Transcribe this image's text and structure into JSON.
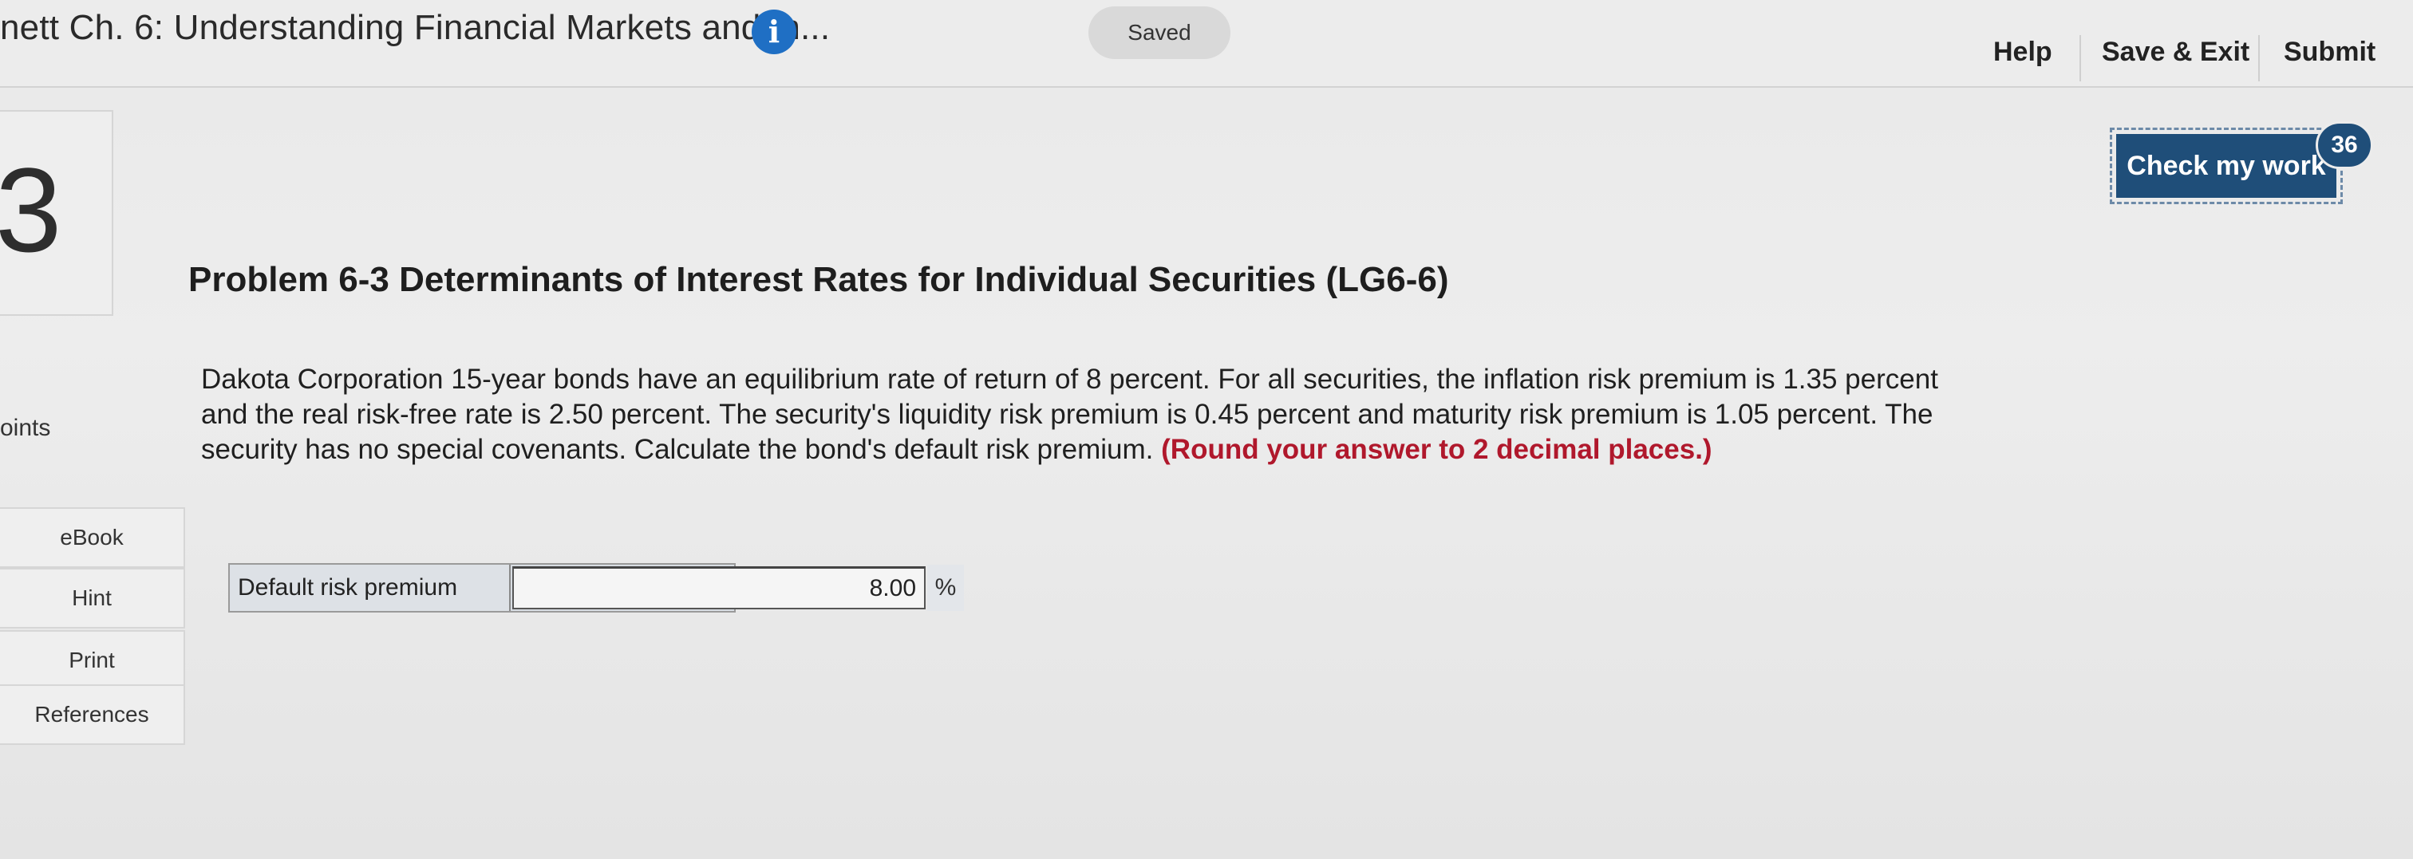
{
  "header": {
    "assignment_title": "nett Ch. 6: Understanding Financial Markets and In...",
    "info_icon": "i",
    "saved_status": "Saved",
    "help_label": "Help",
    "save_exit_label": "Save & Exit",
    "submit_label": "Submit"
  },
  "question": {
    "number": "3",
    "points_label": "oints"
  },
  "tools": {
    "ebook": "eBook",
    "hint": "Hint",
    "print": "Print",
    "references": "References"
  },
  "check_work": {
    "label": "Check my work",
    "remaining_count": "36"
  },
  "problem": {
    "title": "Problem 6-3 Determinants of Interest Rates for Individual Securities (LG6-6)",
    "stem_text": "Dakota Corporation 15-year bonds have an equilibrium rate of return of 8 percent. For all securities, the inflation risk premium is 1.35 percent and the real risk-free rate is 2.50 percent. The security's liquidity risk premium is 0.45 percent and maturity risk premium is 1.05 percent. The security has no special covenants. Calculate the bond's default risk premium.",
    "instruction": "(Round your answer to 2 decimal places.)"
  },
  "answer": {
    "label": "Default risk premium",
    "value": "8.00",
    "unit": "%"
  },
  "colors": {
    "accent_blue": "#1f4e79",
    "info_blue": "#1f6fc4",
    "instruction_red": "#b0182c"
  }
}
